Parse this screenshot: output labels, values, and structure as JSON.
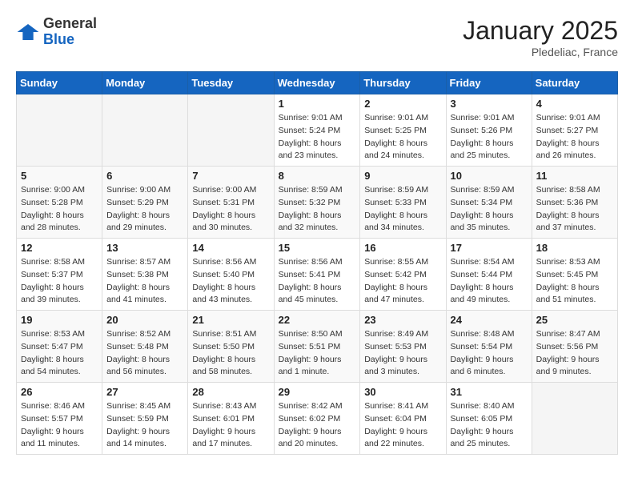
{
  "header": {
    "logo_general": "General",
    "logo_blue": "Blue",
    "month_title": "January 2025",
    "location": "Pledeliac, France"
  },
  "days_of_week": [
    "Sunday",
    "Monday",
    "Tuesday",
    "Wednesday",
    "Thursday",
    "Friday",
    "Saturday"
  ],
  "weeks": [
    [
      {
        "day": "",
        "info": ""
      },
      {
        "day": "",
        "info": ""
      },
      {
        "day": "",
        "info": ""
      },
      {
        "day": "1",
        "info": "Sunrise: 9:01 AM\nSunset: 5:24 PM\nDaylight: 8 hours\nand 23 minutes."
      },
      {
        "day": "2",
        "info": "Sunrise: 9:01 AM\nSunset: 5:25 PM\nDaylight: 8 hours\nand 24 minutes."
      },
      {
        "day": "3",
        "info": "Sunrise: 9:01 AM\nSunset: 5:26 PM\nDaylight: 8 hours\nand 25 minutes."
      },
      {
        "day": "4",
        "info": "Sunrise: 9:01 AM\nSunset: 5:27 PM\nDaylight: 8 hours\nand 26 minutes."
      }
    ],
    [
      {
        "day": "5",
        "info": "Sunrise: 9:00 AM\nSunset: 5:28 PM\nDaylight: 8 hours\nand 28 minutes."
      },
      {
        "day": "6",
        "info": "Sunrise: 9:00 AM\nSunset: 5:29 PM\nDaylight: 8 hours\nand 29 minutes."
      },
      {
        "day": "7",
        "info": "Sunrise: 9:00 AM\nSunset: 5:31 PM\nDaylight: 8 hours\nand 30 minutes."
      },
      {
        "day": "8",
        "info": "Sunrise: 8:59 AM\nSunset: 5:32 PM\nDaylight: 8 hours\nand 32 minutes."
      },
      {
        "day": "9",
        "info": "Sunrise: 8:59 AM\nSunset: 5:33 PM\nDaylight: 8 hours\nand 34 minutes."
      },
      {
        "day": "10",
        "info": "Sunrise: 8:59 AM\nSunset: 5:34 PM\nDaylight: 8 hours\nand 35 minutes."
      },
      {
        "day": "11",
        "info": "Sunrise: 8:58 AM\nSunset: 5:36 PM\nDaylight: 8 hours\nand 37 minutes."
      }
    ],
    [
      {
        "day": "12",
        "info": "Sunrise: 8:58 AM\nSunset: 5:37 PM\nDaylight: 8 hours\nand 39 minutes."
      },
      {
        "day": "13",
        "info": "Sunrise: 8:57 AM\nSunset: 5:38 PM\nDaylight: 8 hours\nand 41 minutes."
      },
      {
        "day": "14",
        "info": "Sunrise: 8:56 AM\nSunset: 5:40 PM\nDaylight: 8 hours\nand 43 minutes."
      },
      {
        "day": "15",
        "info": "Sunrise: 8:56 AM\nSunset: 5:41 PM\nDaylight: 8 hours\nand 45 minutes."
      },
      {
        "day": "16",
        "info": "Sunrise: 8:55 AM\nSunset: 5:42 PM\nDaylight: 8 hours\nand 47 minutes."
      },
      {
        "day": "17",
        "info": "Sunrise: 8:54 AM\nSunset: 5:44 PM\nDaylight: 8 hours\nand 49 minutes."
      },
      {
        "day": "18",
        "info": "Sunrise: 8:53 AM\nSunset: 5:45 PM\nDaylight: 8 hours\nand 51 minutes."
      }
    ],
    [
      {
        "day": "19",
        "info": "Sunrise: 8:53 AM\nSunset: 5:47 PM\nDaylight: 8 hours\nand 54 minutes."
      },
      {
        "day": "20",
        "info": "Sunrise: 8:52 AM\nSunset: 5:48 PM\nDaylight: 8 hours\nand 56 minutes."
      },
      {
        "day": "21",
        "info": "Sunrise: 8:51 AM\nSunset: 5:50 PM\nDaylight: 8 hours\nand 58 minutes."
      },
      {
        "day": "22",
        "info": "Sunrise: 8:50 AM\nSunset: 5:51 PM\nDaylight: 9 hours\nand 1 minute."
      },
      {
        "day": "23",
        "info": "Sunrise: 8:49 AM\nSunset: 5:53 PM\nDaylight: 9 hours\nand 3 minutes."
      },
      {
        "day": "24",
        "info": "Sunrise: 8:48 AM\nSunset: 5:54 PM\nDaylight: 9 hours\nand 6 minutes."
      },
      {
        "day": "25",
        "info": "Sunrise: 8:47 AM\nSunset: 5:56 PM\nDaylight: 9 hours\nand 9 minutes."
      }
    ],
    [
      {
        "day": "26",
        "info": "Sunrise: 8:46 AM\nSunset: 5:57 PM\nDaylight: 9 hours\nand 11 minutes."
      },
      {
        "day": "27",
        "info": "Sunrise: 8:45 AM\nSunset: 5:59 PM\nDaylight: 9 hours\nand 14 minutes."
      },
      {
        "day": "28",
        "info": "Sunrise: 8:43 AM\nSunset: 6:01 PM\nDaylight: 9 hours\nand 17 minutes."
      },
      {
        "day": "29",
        "info": "Sunrise: 8:42 AM\nSunset: 6:02 PM\nDaylight: 9 hours\nand 20 minutes."
      },
      {
        "day": "30",
        "info": "Sunrise: 8:41 AM\nSunset: 6:04 PM\nDaylight: 9 hours\nand 22 minutes."
      },
      {
        "day": "31",
        "info": "Sunrise: 8:40 AM\nSunset: 6:05 PM\nDaylight: 9 hours\nand 25 minutes."
      },
      {
        "day": "",
        "info": ""
      }
    ]
  ]
}
